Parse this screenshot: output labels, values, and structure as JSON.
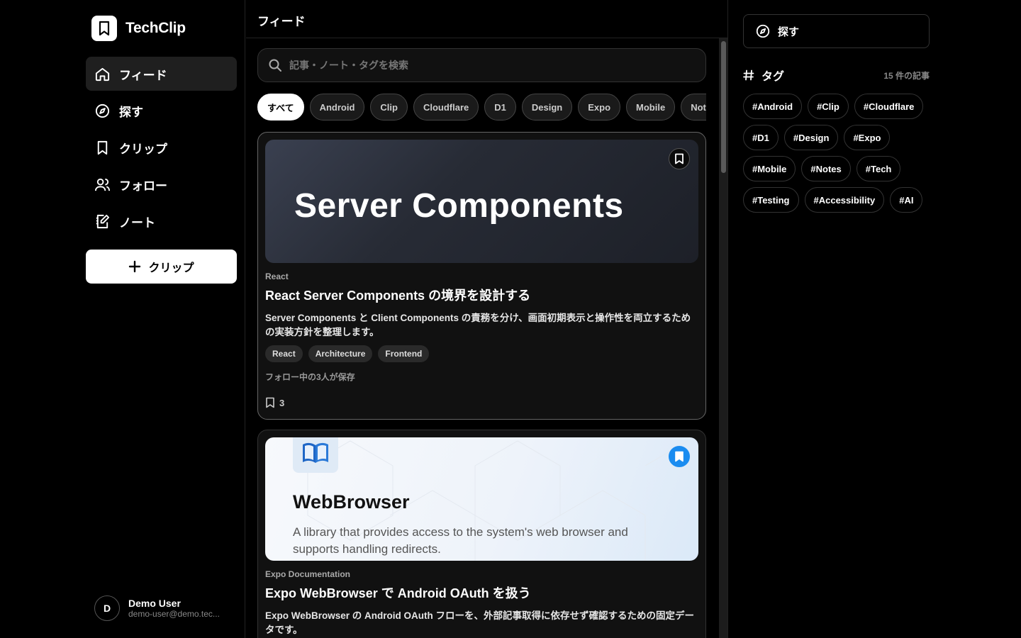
{
  "app": {
    "name": "TechClip"
  },
  "nav": [
    {
      "label": "フィード",
      "icon": "home-icon",
      "active": true
    },
    {
      "label": "探す",
      "icon": "compass-icon",
      "active": false
    },
    {
      "label": "クリップ",
      "icon": "bookmark-icon",
      "active": false
    },
    {
      "label": "フォロー",
      "icon": "users-icon",
      "active": false
    },
    {
      "label": "ノート",
      "icon": "note-icon",
      "active": false
    }
  ],
  "clip_button": {
    "label": "クリップ",
    "icon": "plus-icon"
  },
  "user": {
    "initial": "D",
    "name": "Demo User",
    "email": "demo-user@demo.tec..."
  },
  "feed": {
    "header": "フィード",
    "search_placeholder": "記事・ノート・タグを検索",
    "filters": [
      "すべて",
      "Android",
      "Clip",
      "Cloudflare",
      "D1",
      "Design",
      "Expo",
      "Mobile",
      "Notes"
    ],
    "cards": [
      {
        "thumb_title": "Server Components",
        "source": "React",
        "title": "React Server Components の境界を設計する",
        "description": "Server Components と Client Components の責務を分け、画面初期表示と操作性を両立するための実装方針を整理します。",
        "tags": [
          "React",
          "Architecture",
          "Frontend"
        ],
        "saved_by": "フォロー中の3人が保存",
        "bookmark_count": "3",
        "bookmarked": false
      },
      {
        "thumb_title": "WebBrowser",
        "thumb_desc": "A library that provides access to the system's web browser and supports handling redirects.",
        "source": "Expo Documentation",
        "title": "Expo WebBrowser で Android OAuth を扱う",
        "description": "Expo WebBrowser の Android OAuth フローを、外部記事取得に依存せず確認するための固定データです。",
        "bookmarked": true
      }
    ]
  },
  "right": {
    "explore_label": "探す",
    "tags_title": "タグ",
    "tags_count": "15 件の記事",
    "tags": [
      "#Android",
      "#Clip",
      "#Cloudflare",
      "#D1",
      "#Design",
      "#Expo",
      "#Mobile",
      "#Notes",
      "#Tech",
      "#Testing",
      "#Accessibility",
      "#AI"
    ]
  },
  "colors": {
    "background": "#000000",
    "accent_bookmark": "#1a8cf0",
    "surface": "#111111"
  }
}
